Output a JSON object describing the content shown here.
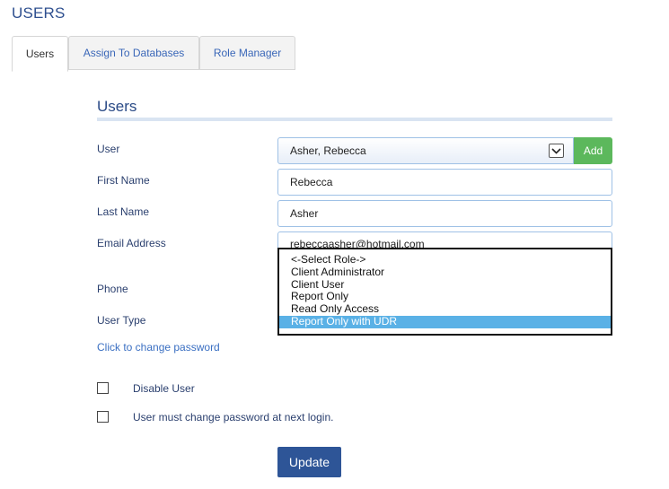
{
  "page": {
    "title": "USERS"
  },
  "tabs": [
    {
      "label": "Users",
      "active": true
    },
    {
      "label": "Assign To Databases",
      "active": false
    },
    {
      "label": "Role Manager",
      "active": false
    }
  ],
  "section": {
    "title": "Users"
  },
  "form": {
    "user_label": "User",
    "user_value": "Asher, Rebecca",
    "add_label": "Add",
    "first_name_label": "First Name",
    "first_name_value": "Rebecca",
    "last_name_label": "Last Name",
    "last_name_value": "Asher",
    "email_label": "Email Address",
    "email_value": "rebeccaasher@hotmail.com",
    "phone_label": "Phone",
    "user_type_label": "User Type",
    "change_password_link": "Click to change password",
    "disable_user_label": "Disable User",
    "must_change_label": "User must change password at next login.",
    "update_label": "Update"
  },
  "role_dropdown": {
    "options": [
      "<-Select Role->",
      "Client Administrator",
      "Client User",
      "Report Only",
      "Read Only Access",
      "Report Only with UDR"
    ],
    "selected": "Report Only with UDR"
  },
  "colors": {
    "accent": "#2e5597",
    "add": "#5cb85c",
    "highlight": "#5ab1e6",
    "link": "#3a6fc2"
  }
}
